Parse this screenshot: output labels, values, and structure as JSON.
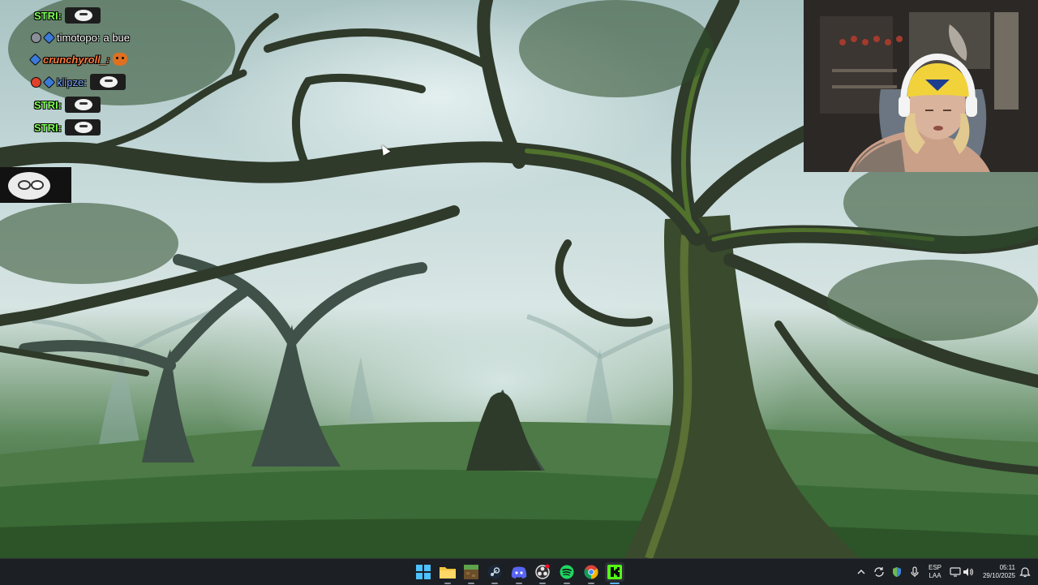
{
  "chat": {
    "lines": [
      {
        "user": "STRI:",
        "message": ""
      },
      {
        "user": "timotopo:",
        "message": "a bue"
      },
      {
        "user": "crunchyroll_:",
        "message": ""
      },
      {
        "user": "klipze:",
        "message": ""
      },
      {
        "user": "STRI:",
        "message": ""
      },
      {
        "user": "STRI:",
        "message": ""
      }
    ]
  },
  "webcam": {
    "beanie_color": "#f2d23a"
  },
  "taskbar": {
    "apps": [
      {
        "name": "start-button",
        "icon": "windows-icon"
      },
      {
        "name": "file-explorer",
        "icon": "folder-icon"
      },
      {
        "name": "minecraft",
        "icon": "minecraft-icon"
      },
      {
        "name": "steam",
        "icon": "steam-icon"
      },
      {
        "name": "discord",
        "icon": "discord-icon"
      },
      {
        "name": "obs-studio",
        "icon": "obs-icon"
      },
      {
        "name": "spotify",
        "icon": "spotify-icon"
      },
      {
        "name": "chrome",
        "icon": "chrome-icon"
      },
      {
        "name": "kick",
        "icon": "kick-icon"
      }
    ],
    "tray": {
      "language_top": "ESP",
      "language_bottom": "LAA",
      "time": "05:11",
      "date": "29/10/2025"
    }
  },
  "colors": {
    "taskbar_bg": "#1c1f24",
    "accent": "#5ab0ff",
    "chat_name_green": "#7cff52"
  }
}
